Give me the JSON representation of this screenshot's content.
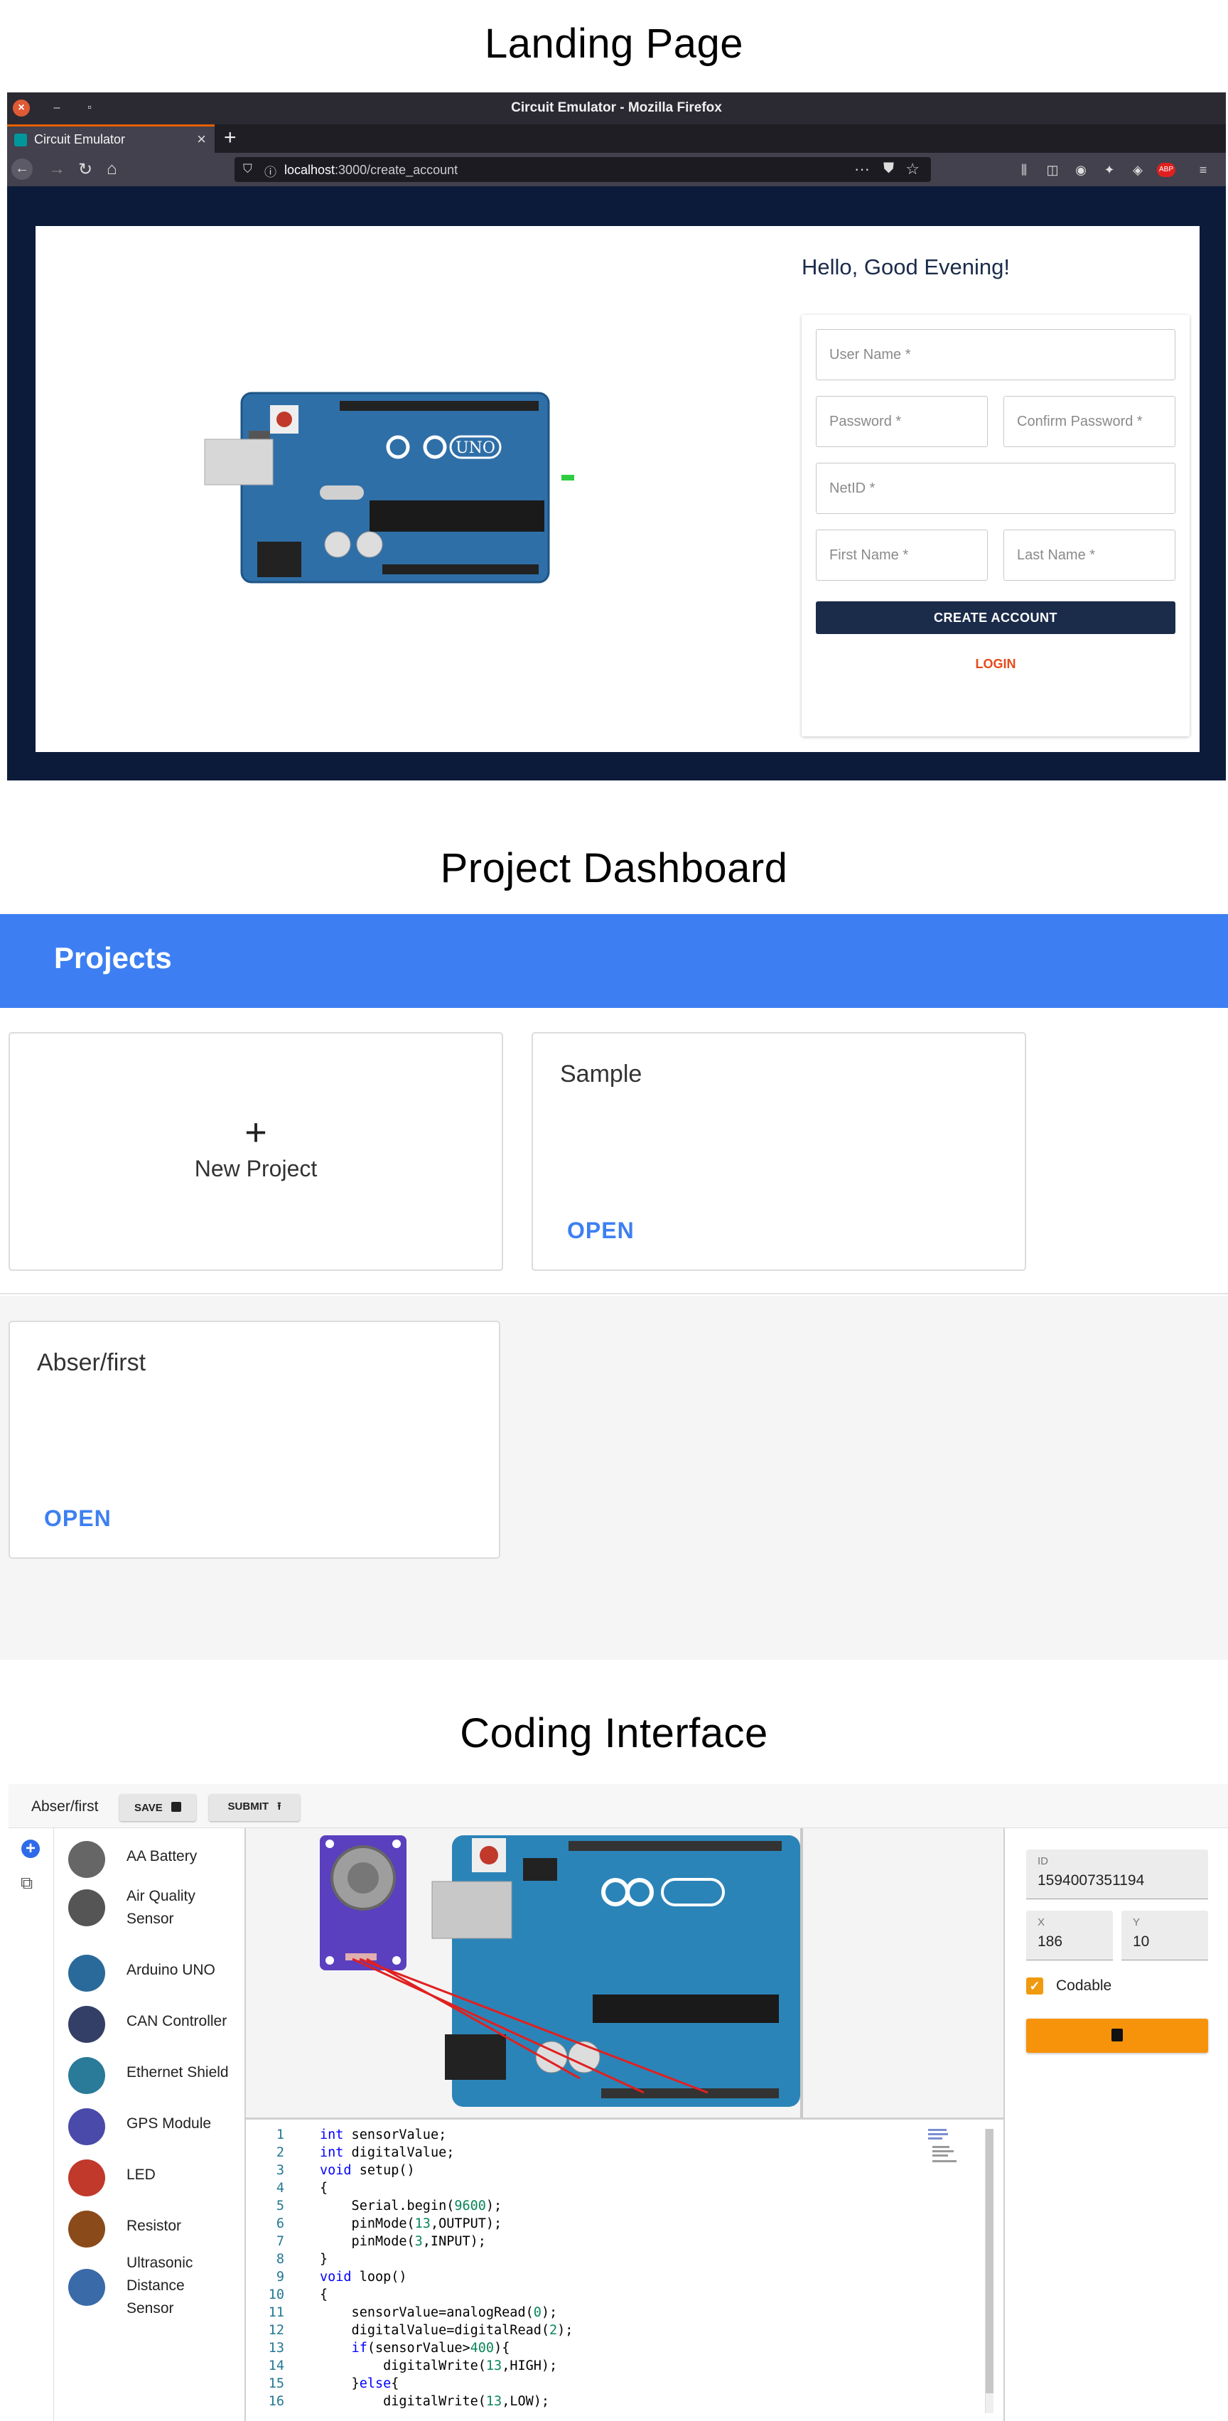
{
  "sections": {
    "landing_title": "Landing Page",
    "dashboard_title": "Project Dashboard",
    "coding_title": "Coding Interface"
  },
  "browser": {
    "window_title": "Circuit Emulator - Mozilla Firefox",
    "tab_label": "Circuit Emulator",
    "url_host": "localhost",
    "url_rest": ":3000/create_account"
  },
  "landing": {
    "greeting": "Hello, Good Evening!",
    "fields": {
      "username": "User Name *",
      "password": "Password *",
      "confirm_password": "Confirm Password *",
      "netid": "NetID *",
      "first_name": "First Name *",
      "last_name": "Last Name *"
    },
    "create_account_label": "CREATE ACCOUNT",
    "login_label": "LOGIN",
    "board_label": "UNO"
  },
  "dashboard": {
    "header_title": "Projects",
    "new_project_label": "New Project",
    "new_project_icon": "+",
    "projects": [
      {
        "title": "Sample",
        "open_label": "OPEN"
      },
      {
        "title": "Abser/first",
        "open_label": "OPEN"
      }
    ],
    "accent_color": "#3d7ff2"
  },
  "ide": {
    "project_name": "Abser/first",
    "save_label": "SAVE",
    "submit_label": "SUBMIT",
    "components": [
      {
        "label": "AA Battery",
        "icon": "battery-icon"
      },
      {
        "label": "Air Quality Sensor",
        "icon": "air-quality-sensor-icon"
      },
      {
        "label": "Arduino UNO",
        "icon": "arduino-icon"
      },
      {
        "label": "CAN Controller",
        "icon": "can-controller-icon"
      },
      {
        "label": "Ethernet Shield",
        "icon": "ethernet-shield-icon"
      },
      {
        "label": "GPS Module",
        "icon": "gps-module-icon"
      },
      {
        "label": "LED",
        "icon": "led-icon"
      },
      {
        "label": "Resistor",
        "icon": "resistor-icon"
      },
      {
        "label": "Ultrasonic Distance Sensor",
        "icon": "ultrasonic-sensor-icon"
      }
    ],
    "code_lines": [
      "int sensorValue;",
      "int digitalValue;",
      "void setup()",
      "{",
      "    Serial.begin(9600);",
      "    pinMode(13,OUTPUT);",
      "    pinMode(3,INPUT);",
      "}",
      "void loop()",
      "{",
      "    sensorValue=analogRead(0);",
      "    digitalValue=digitalRead(2);",
      "    if(sensorValue>400){",
      "        digitalWrite(13,HIGH);",
      "    }else{",
      "        digitalWrite(13,LOW);"
    ],
    "properties": {
      "id_label": "ID",
      "id_value": "1594007351194",
      "x_label": "X",
      "x_value": "186",
      "y_label": "Y",
      "y_value": "10",
      "codable_label": "Codable",
      "codable_checked": true
    },
    "accent_color": "#f7930a"
  }
}
